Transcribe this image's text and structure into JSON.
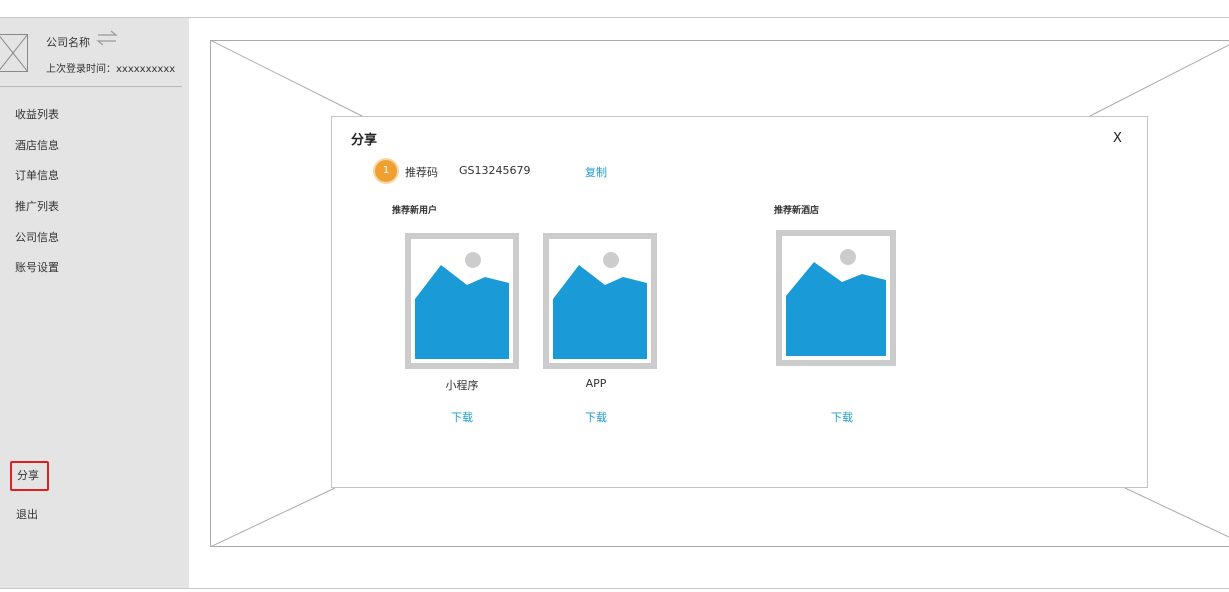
{
  "sidebar": {
    "company_name": "公司名称",
    "last_login": "上次登录时间：xxxxxxxxxx",
    "menu": [
      "收益列表",
      "酒店信息",
      "订单信息",
      "推广列表",
      "公司信息",
      "账号设置"
    ],
    "share": "分享",
    "logout": "退出"
  },
  "modal": {
    "title": "分享",
    "close": "X",
    "badge": "1",
    "ref_label": "推荐码",
    "ref_code": "GS13245679",
    "copy": "复制",
    "section_users": "推荐新用户",
    "section_hotels": "推荐新酒店",
    "items": [
      {
        "caption": "小程序",
        "download": "下载"
      },
      {
        "caption": "APP",
        "download": "下载"
      },
      {
        "caption": "",
        "download": "下载"
      }
    ]
  },
  "colors": {
    "accent": "#1e9bd0",
    "image_fill": "#1a9ad6",
    "badge": "#f0a030",
    "highlight": "#e02020"
  },
  "icons": [
    "image-placeholder-icon",
    "swap-arrows-icon",
    "avatar-placeholder-icon"
  ]
}
